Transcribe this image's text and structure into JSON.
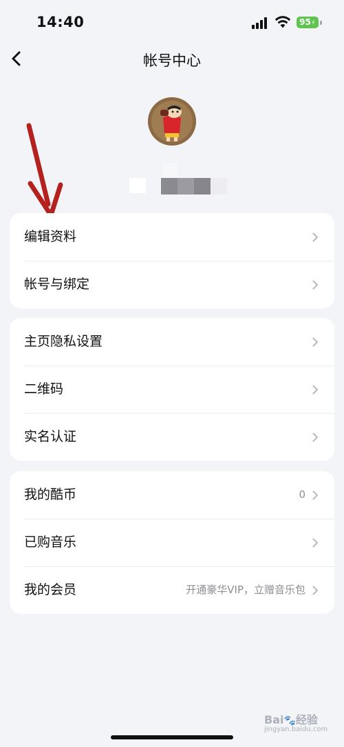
{
  "status": {
    "time": "14:40",
    "battery": "95"
  },
  "nav": {
    "title": "帐号中心",
    "back_icon": "chevron-left-icon"
  },
  "profile": {
    "avatar_icon": "cartoon-avatar"
  },
  "sections": [
    {
      "items": [
        {
          "label": "编辑资料",
          "value": ""
        },
        {
          "label": "帐号与绑定",
          "value": ""
        }
      ]
    },
    {
      "items": [
        {
          "label": "主页隐私设置",
          "value": ""
        },
        {
          "label": "二维码",
          "value": ""
        },
        {
          "label": "实名认证",
          "value": ""
        }
      ]
    },
    {
      "items": [
        {
          "label": "我的酷币",
          "value": "0"
        },
        {
          "label": "已购音乐",
          "value": ""
        },
        {
          "label": "我的会员",
          "value": "开通豪华VIP，立赠音乐包"
        }
      ]
    }
  ],
  "annotation": {
    "arrow_color": "#b3221e"
  },
  "watermark": {
    "text": "Bai",
    "suffix": "经验",
    "sub": "jingyan.baidu.com"
  },
  "colors": {
    "background": "#f3f4f8",
    "card": "#ffffff",
    "secondary_text": "#8e8e93",
    "battery": "#5ec44f"
  }
}
